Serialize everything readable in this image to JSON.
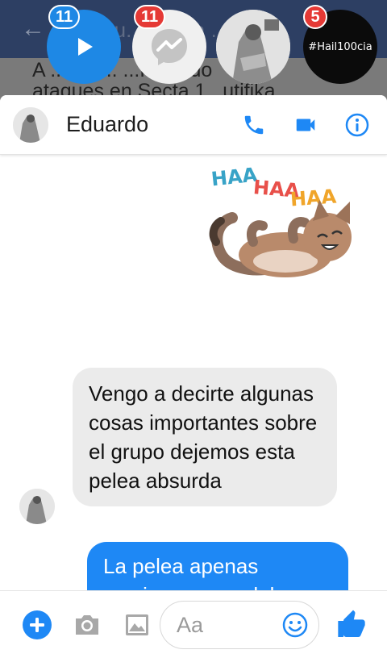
{
  "background_app": {
    "back_glyph": "←",
    "title": "...u... ...ncia ... ...c",
    "headline_line1": "A ...stru... ...P... ...do",
    "headline_line2": "ataques en Secta 1...utifika"
  },
  "chat_heads": [
    {
      "badge": "11",
      "icon": "play-icon",
      "color": "#1e88e5"
    },
    {
      "badge": "11",
      "icon": "messenger-icon",
      "color": "#f0f0f0"
    },
    {
      "badge": "",
      "icon": "avatar",
      "color": "#e7e7e7"
    },
    {
      "badge": "5",
      "icon": "hashtag-page",
      "label": "#Hail100cia",
      "color": "#0b0b0b"
    }
  ],
  "chat": {
    "contact_name": "Eduardo",
    "header_icons": [
      "phone-icon",
      "video-camera-icon",
      "info-icon"
    ],
    "accent_color": "#1e88f5",
    "sticker": {
      "text_1": "HAA",
      "text_2": "HAA",
      "text_3": "HAA"
    },
    "messages": [
      {
        "direction": "incoming",
        "text": "Vengo a decirte algunas cosas importantes sobre el grupo dejemos esta pelea absurda"
      },
      {
        "direction": "outgoing",
        "text": "La pelea apenas comienza pero debo aplaudir tu eres el único adminis de..."
      }
    ]
  },
  "composer": {
    "placeholder": "Aa",
    "icons": [
      "plus-icon",
      "camera-icon",
      "gallery-icon",
      "emoji-icon",
      "thumbs-up-icon"
    ]
  }
}
